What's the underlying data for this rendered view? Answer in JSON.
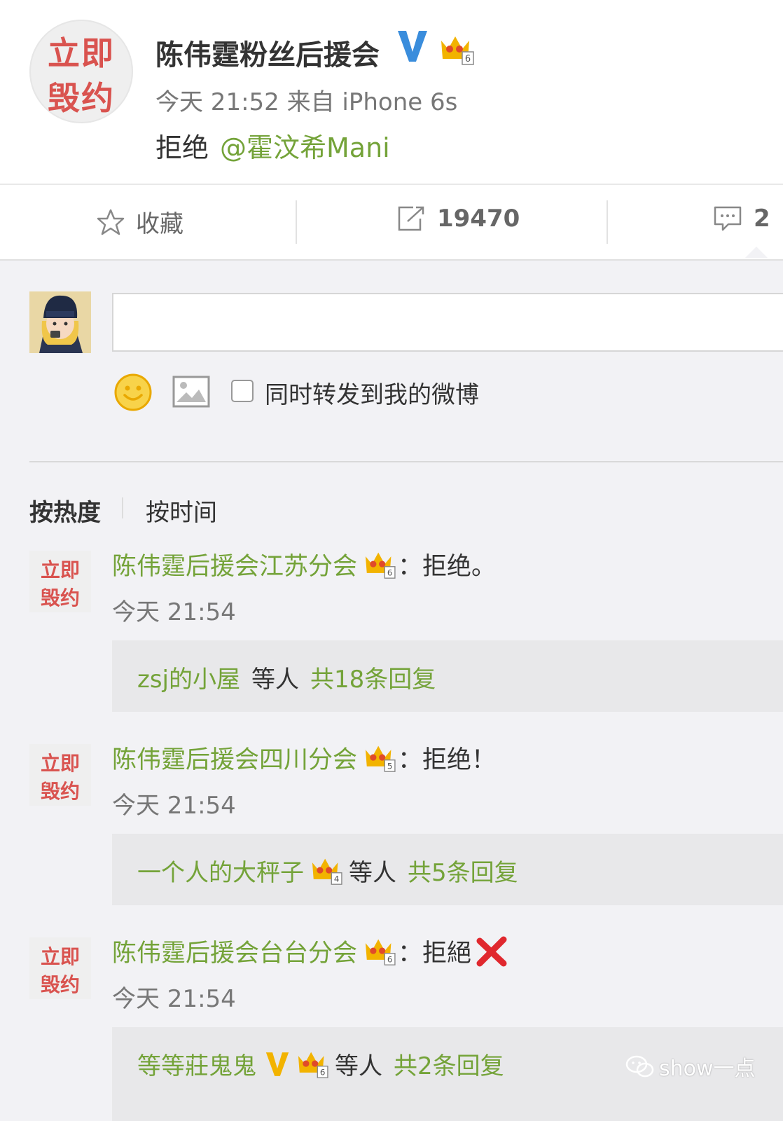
{
  "post": {
    "avatar_line1": "立即",
    "avatar_line2": "毁约",
    "author": "陈伟霆粉丝后援会",
    "time_source": "今天 21:52 来自 iPhone 6s",
    "content_text": "拒绝",
    "mention": "@霍汶希Mani",
    "badge_level": "6"
  },
  "actions": {
    "favorite_label": "收藏",
    "repost_count": "19470",
    "comment_count": "2"
  },
  "composer": {
    "input_value": "",
    "repost_checkbox_label": "同时转发到我的微博",
    "repost_checked": false
  },
  "sort": {
    "hot": "按热度",
    "time": "按时间"
  },
  "comments": [
    {
      "avatar_line1": "立即",
      "avatar_line2": "毁约",
      "user": "陈伟霆后援会江苏分会",
      "badge_level": "6",
      "text": "：拒绝。",
      "time": "今天 21:54",
      "reply_user": "zsj的小屋",
      "reply_mid": "等人",
      "reply_count": "共18条回复"
    },
    {
      "avatar_line1": "立即",
      "avatar_line2": "毁约",
      "user": "陈伟霆后援会四川分会",
      "badge_level": "5",
      "text": "：拒绝！",
      "time": "今天 21:54",
      "reply_user": "一个人的大秤子",
      "reply_badge": "4",
      "reply_mid": "等人",
      "reply_count": "共5条回复"
    },
    {
      "avatar_line1": "立即",
      "avatar_line2": "毁约",
      "user": "陈伟霆后援会台台分会",
      "badge_level": "6",
      "text": "：拒絕",
      "time": "今天 21:54",
      "reply_user": "等等莊鬼鬼",
      "reply_badge": "6",
      "reply_mid": "等人",
      "reply_count": "共2条回复"
    }
  ],
  "watermark": "show一点",
  "colors": {
    "link_green": "#74a339",
    "avatar_red": "#d9534f",
    "verified_blue": "#3a8ddc",
    "verified_gold": "#f2b300",
    "cross_red": "#e0282e"
  }
}
